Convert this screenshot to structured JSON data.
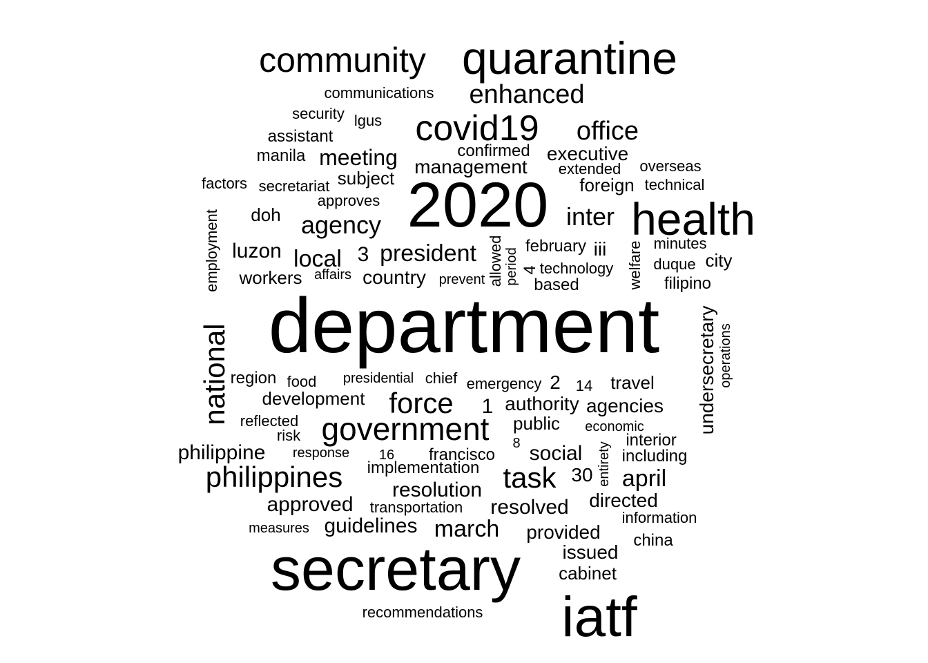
{
  "words": [
    "department",
    "2020",
    "secretary",
    "health",
    "quarantine",
    "iatf",
    "community",
    "covid19",
    "national",
    "government",
    "philippines",
    "enhanced",
    "office",
    "force",
    "task",
    "agency",
    "president",
    "april",
    "march",
    "inter",
    "local",
    "resolved",
    "meeting",
    "executive",
    "luzon",
    "management",
    "philippine",
    "resolution",
    "approved",
    "guidelines",
    "development",
    "social",
    "country",
    "authority",
    "agencies",
    "directed",
    "undersecretary",
    "employment",
    "doh",
    "workers",
    "subject",
    "implementation",
    "transportation",
    "provided",
    "issued",
    "cabinet",
    "travel",
    "public",
    "interior",
    "including",
    "francisco",
    "foreign",
    "communications",
    "confirmed",
    "security",
    "lgus",
    "assistant",
    "manila",
    "extended",
    "overseas",
    "factors",
    "secretariat",
    "technical",
    "approves",
    "minutes",
    "city",
    "duque",
    "filipino",
    "february",
    "iii",
    "technology",
    "based",
    "allowed",
    "period",
    "welfare",
    "affairs",
    "prevent",
    "operations",
    "region",
    "food",
    "presidential",
    "chief",
    "emergency",
    "reflected",
    "risk",
    "economic",
    "response",
    "entirety",
    "information",
    "measures",
    "china",
    "recommendations",
    "3",
    "4",
    "2",
    "14",
    "1",
    "8",
    "16",
    "30"
  ],
  "text_color": "#000000",
  "background_color": "#ffffff"
}
